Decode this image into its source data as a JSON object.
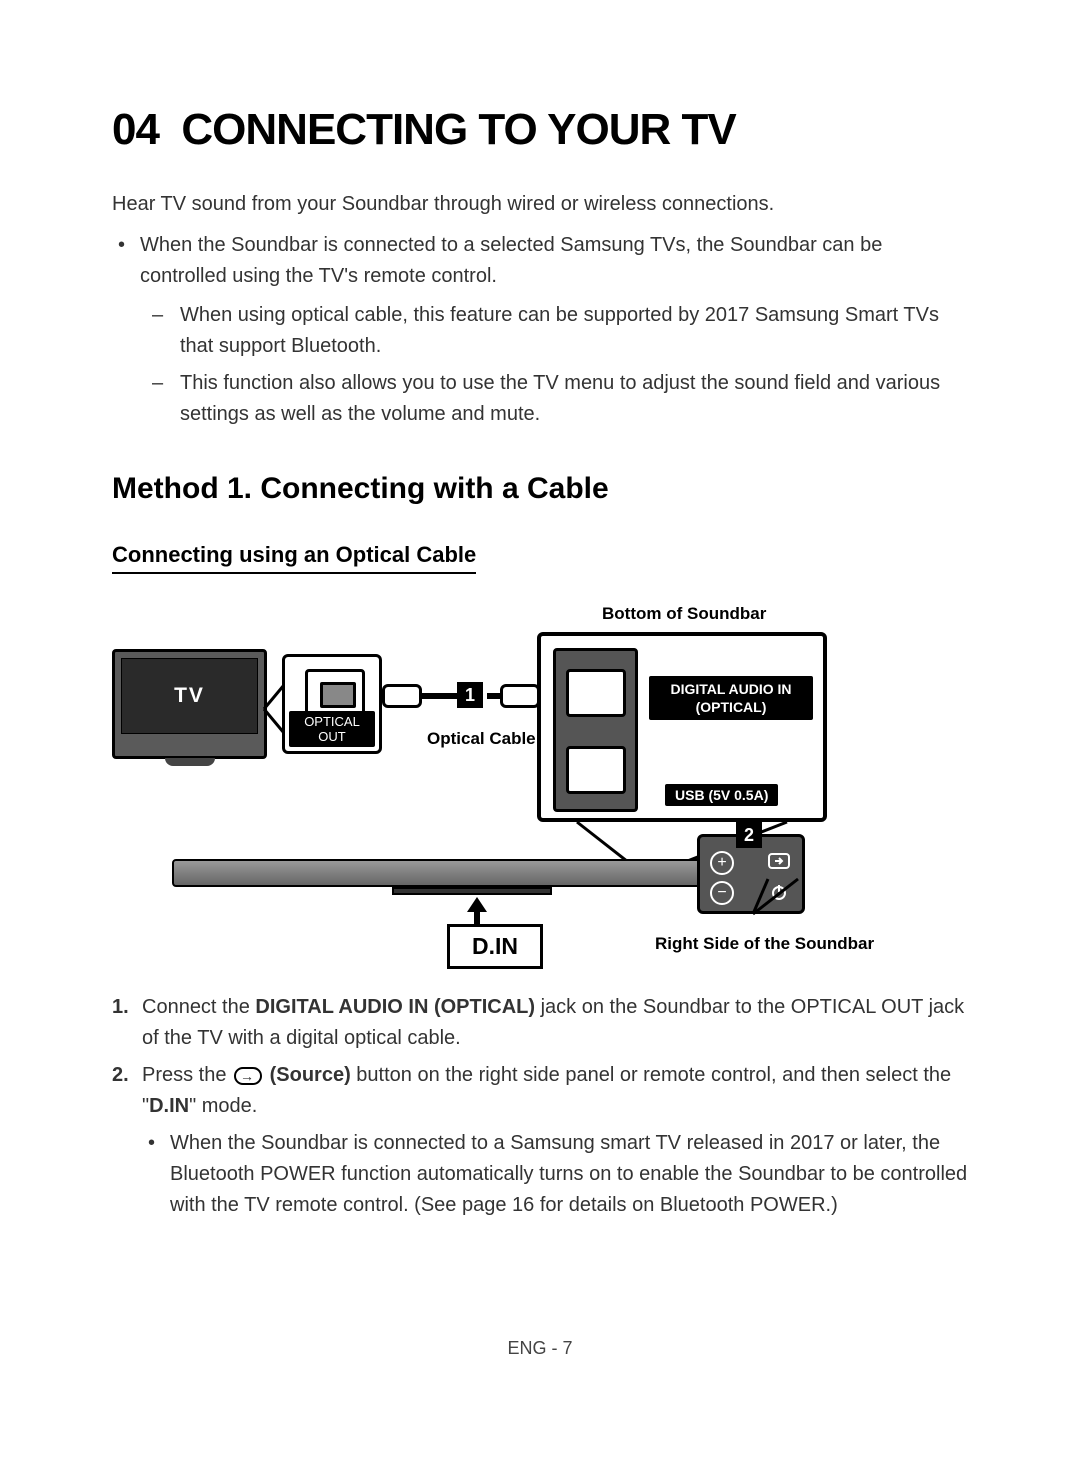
{
  "section": {
    "number": "04",
    "title": "CONNECTING TO YOUR TV"
  },
  "intro": "Hear TV sound from your Soundbar through wired or wireless connections.",
  "bullets": [
    "When the Soundbar is connected to a selected Samsung TVs, the Soundbar can be controlled using the TV's remote control."
  ],
  "dashes": [
    "When using optical cable, this feature can be supported by 2017 Samsung Smart TVs that support Bluetooth.",
    "This function also allows you to use the TV menu to adjust the sound field and various settings as well as the volume and mute."
  ],
  "method_title": "Method 1. Connecting with a Cable",
  "sub_title": "Connecting using an Optical Cable",
  "diagram": {
    "top_label": "Bottom of Soundbar",
    "tv_label": "TV",
    "optical_out": "OPTICAL OUT",
    "cable_label": "Optical Cable",
    "digital_in": "DIGITAL AUDIO IN (OPTICAL)",
    "usb": "USB (5V 0.5A)",
    "din": "D.IN",
    "right_side": "Right Side of the Soundbar",
    "num1": "1",
    "num2": "2"
  },
  "steps": {
    "s1_a": "Connect the ",
    "s1_b": "DIGITAL AUDIO IN (OPTICAL)",
    "s1_c": " jack on the Soundbar to the OPTICAL OUT jack of the TV with a digital optical cable.",
    "s2_a": "Press the ",
    "s2_b": "(Source)",
    "s2_c": " button on the right side panel or remote control, and then select the \"",
    "s2_d": "D.IN",
    "s2_e": "\" mode.",
    "s2_bullet": "When the Soundbar is connected to a Samsung smart TV released in 2017 or later, the Bluetooth POWER function automatically turns on to enable the Soundbar to be controlled with the TV remote control. (See page 16 for details on Bluetooth POWER.)"
  },
  "footer": "ENG - 7"
}
